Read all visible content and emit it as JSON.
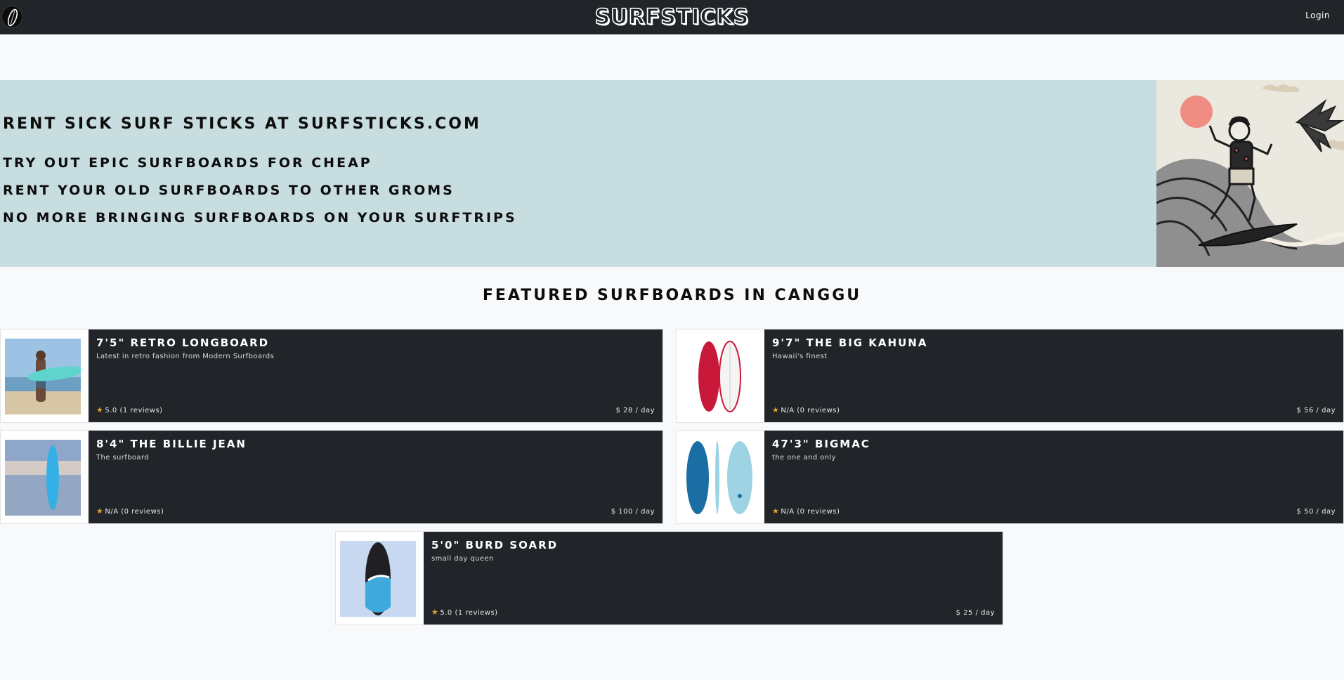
{
  "header": {
    "brand": "SURFSTICKS",
    "login_label": "Login",
    "logo_icon": "surfboard-logo-icon"
  },
  "hero": {
    "title": "Rent sick surf sticks at surfsticks.com",
    "lines": [
      "Try out epic surfboards for cheap",
      "Rent your old surfboards to other groms",
      "No more bringing surfboards on your surftrips"
    ],
    "background": "#c7dde0"
  },
  "featured": {
    "heading": "Featured surfboards in Canggu",
    "listings": [
      {
        "name": "7'5\" Retro Longboard",
        "description": "Latest in retro fashion from Modern Surfboards",
        "rating": "5.0 (1 reviews)",
        "price": "$ 28 / day",
        "photo": "person-holding-turquoise-longboard"
      },
      {
        "name": "9'7\" The Big Kahuna",
        "description": "Hawaii's finest",
        "rating": "N/A (0 reviews)",
        "price": "$ 56 / day",
        "photo": "red-surfboard-front-and-back"
      },
      {
        "name": "8'4\" The Billie Jean",
        "description": "The surfboard",
        "rating": "N/A (0 reviews)",
        "price": "$ 100 / day",
        "photo": "blue-surfboard-on-beach"
      },
      {
        "name": "47'3\" BIGMAC",
        "description": "the one and only",
        "rating": "N/A (0 reviews)",
        "price": "$ 50 / day",
        "photo": "blue-fish-surfboard-views"
      },
      {
        "name": "5'0\" Burd Soard",
        "description": "small day queen",
        "rating": "5.0 (1 reviews)",
        "price": "$ 25 / day",
        "photo": "black-blue-resin-surfboard"
      }
    ]
  },
  "colors": {
    "nav": "#212429",
    "card": "#212429",
    "star": "#e3a02a",
    "hero": "#c7dde0",
    "page": "#f7f9fb"
  }
}
